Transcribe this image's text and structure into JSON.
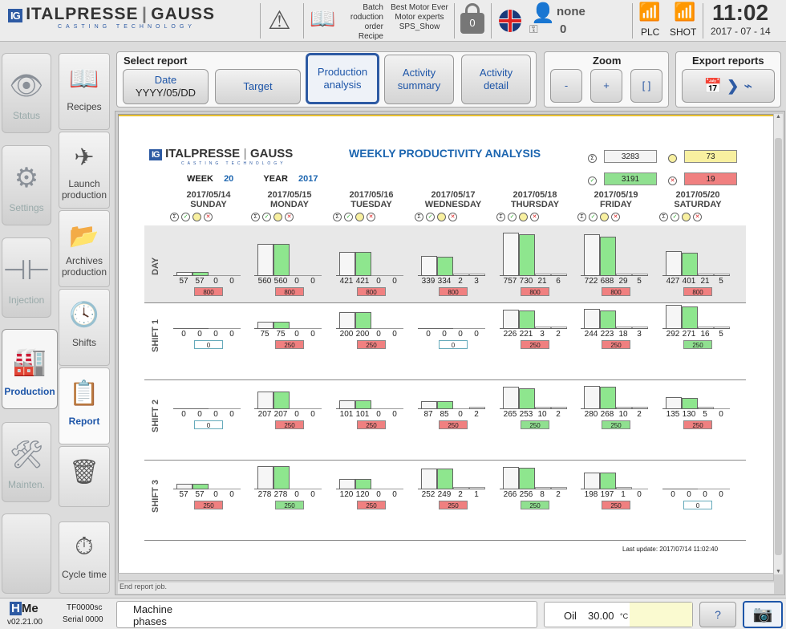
{
  "header": {
    "logo_mark": "IG",
    "logo_name": "ITALPRESSE",
    "logo_name2": "GAUSS",
    "logo_sub": "CASTING TECHNOLOGY",
    "batch_label": "Batch",
    "production_order_label": "roduction order",
    "recipe_label": "Recipe",
    "batch_value": "Best Motor Ever",
    "production_order_value": "Motor experts",
    "recipe_value": "SPS_Show",
    "lock_count": "0",
    "user_name": "none",
    "user_count": "0",
    "plc_label": "PLC",
    "shot_label": "SHOT",
    "time": "11:02",
    "date": "2017 - 07 - 14"
  },
  "sidebar": [
    {
      "label": "Status",
      "icon": "eye-icon"
    },
    {
      "label": "Settings",
      "icon": "gears-icon"
    },
    {
      "label": "Injection",
      "icon": "injection-icon"
    },
    {
      "label": "Production",
      "icon": "factory-icon"
    },
    {
      "label": "Mainten.",
      "icon": "tools-icon"
    },
    {
      "label": "",
      "icon": ""
    }
  ],
  "subnav": [
    {
      "label": "Recipes",
      "icon": "book-icon"
    },
    {
      "label": "Launch production",
      "icon": "paper-plane-icon"
    },
    {
      "label": "Archives production",
      "icon": "folder-icon"
    },
    {
      "label": "Shifts",
      "icon": "clock-icon"
    },
    {
      "label": "Report",
      "icon": "report-icon"
    },
    {
      "label": "",
      "icon": "trash-icon"
    },
    {
      "label": "Cycle time",
      "icon": "stopwatch-icon"
    }
  ],
  "select_report": {
    "title": "Select report",
    "date_label": "Date",
    "date_value": "YYYY/05/DD",
    "target": "Target",
    "production_analysis": "Production analysis",
    "activity_summary": "Activity summary",
    "activity_detail": "Activity detail"
  },
  "zoom": {
    "title": "Zoom",
    "minus": "-",
    "plus": "+",
    "fit": "[ ]"
  },
  "export": {
    "title": "Export reports"
  },
  "report": {
    "logo_name": "ITALPRESSE",
    "logo_name2": "GAUSS",
    "logo_sub": "CASTING TECHNOLOGY",
    "title": "WEEKLY PRODUCTIVITY ANALYSIS",
    "week_label": "WEEK",
    "week": "20",
    "year_label": "YEAR",
    "year": "2017",
    "sum_total": "3283",
    "sum_warn": "73",
    "sum_ok": "3191",
    "sum_ko": "19",
    "last_update": "Last update: 2017/07/14 11:02:40",
    "days": [
      {
        "date": "2017/05/14",
        "name": "SUNDAY"
      },
      {
        "date": "2017/05/15",
        "name": "MONDAY"
      },
      {
        "date": "2017/05/16",
        "name": "TUESDAY"
      },
      {
        "date": "2017/05/17",
        "name": "WEDNESDAY"
      },
      {
        "date": "2017/05/18",
        "name": "THURSDAY"
      },
      {
        "date": "2017/05/19",
        "name": "FRIDAY"
      },
      {
        "date": "2017/05/20",
        "name": "SATURDAY"
      }
    ],
    "rows": [
      {
        "label": "DAY",
        "values": [
          [
            "57",
            "57",
            "0",
            "0"
          ],
          [
            "560",
            "560",
            "0",
            "0"
          ],
          [
            "421",
            "421",
            "0",
            "0"
          ],
          [
            "339",
            "334",
            "2",
            "3"
          ],
          [
            "757",
            "730",
            "21",
            "6"
          ],
          [
            "722",
            "688",
            "29",
            "5"
          ],
          [
            "427",
            "401",
            "21",
            "5"
          ]
        ],
        "targets": [
          [
            "800",
            "red"
          ],
          [
            "800",
            "red"
          ],
          [
            "800",
            "red"
          ],
          [
            "800",
            "red"
          ],
          [
            "800",
            "red"
          ],
          [
            "800",
            "red"
          ],
          [
            "800",
            "red"
          ]
        ]
      },
      {
        "label": "SHIFT 1",
        "values": [
          [
            "0",
            "0",
            "0",
            "0"
          ],
          [
            "75",
            "75",
            "0",
            "0"
          ],
          [
            "200",
            "200",
            "0",
            "0"
          ],
          [
            "0",
            "0",
            "0",
            "0"
          ],
          [
            "226",
            "221",
            "3",
            "2"
          ],
          [
            "244",
            "223",
            "18",
            "3"
          ],
          [
            "292",
            "271",
            "16",
            "5"
          ]
        ],
        "targets": [
          [
            "0",
            "white"
          ],
          [
            "250",
            "red"
          ],
          [
            "250",
            "red"
          ],
          [
            "0",
            "white"
          ],
          [
            "250",
            "red"
          ],
          [
            "250",
            "red"
          ],
          [
            "250",
            "green"
          ]
        ]
      },
      {
        "label": "SHIFT 2",
        "values": [
          [
            "0",
            "0",
            "0",
            "0"
          ],
          [
            "207",
            "207",
            "0",
            "0"
          ],
          [
            "101",
            "101",
            "0",
            "0"
          ],
          [
            "87",
            "85",
            "0",
            "2"
          ],
          [
            "265",
            "253",
            "10",
            "2"
          ],
          [
            "280",
            "268",
            "10",
            "2"
          ],
          [
            "135",
            "130",
            "5",
            "0"
          ]
        ],
        "targets": [
          [
            "0",
            "white"
          ],
          [
            "250",
            "red"
          ],
          [
            "250",
            "red"
          ],
          [
            "250",
            "red"
          ],
          [
            "250",
            "green"
          ],
          [
            "250",
            "green"
          ],
          [
            "250",
            "red"
          ]
        ]
      },
      {
        "label": "SHIFT 3",
        "values": [
          [
            "57",
            "57",
            "0",
            "0"
          ],
          [
            "278",
            "278",
            "0",
            "0"
          ],
          [
            "120",
            "120",
            "0",
            "0"
          ],
          [
            "252",
            "249",
            "2",
            "1"
          ],
          [
            "266",
            "256",
            "8",
            "2"
          ],
          [
            "198",
            "197",
            "1",
            "0"
          ],
          [
            "0",
            "0",
            "0",
            "0"
          ]
        ],
        "targets": [
          [
            "250",
            "red"
          ],
          [
            "250",
            "green"
          ],
          [
            "250",
            "red"
          ],
          [
            "250",
            "red"
          ],
          [
            "250",
            "green"
          ],
          [
            "250",
            "red"
          ],
          [
            "0",
            "white"
          ]
        ]
      }
    ]
  },
  "status_line": "End report job.",
  "footer": {
    "brand": "HMe",
    "version": "v02.21.00",
    "machine_code": "TF0000sc",
    "serial": "Serial 0000",
    "machine_phases": "Machine phases",
    "oil_label": "Oil",
    "oil_value": "30.00",
    "oil_unit": "°C",
    "help": "?"
  },
  "colors": {
    "accent": "#2d5aa3",
    "good": "#90e090",
    "bad": "#f08080",
    "warn": "#f8f0a0"
  }
}
